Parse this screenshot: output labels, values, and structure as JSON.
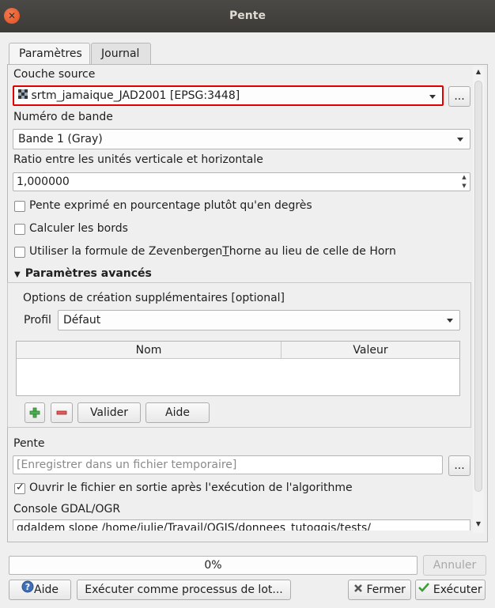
{
  "window": {
    "title": "Pente"
  },
  "tabs": [
    {
      "label": "Paramètres"
    },
    {
      "label": "Journal"
    }
  ],
  "source_layer": {
    "label": "Couche source",
    "value": "srtm_jamaique_JAD2001 [EPSG:3448]",
    "browse": "..."
  },
  "band": {
    "label": "Numéro de bande",
    "value": "Bande 1 (Gray)"
  },
  "ratio": {
    "label": "Ratio entre les unités verticale et horizontale",
    "value": "1,000000"
  },
  "options": {
    "percent": {
      "label": "Pente exprimé en pourcentage plutôt qu'en degrès",
      "checked": false
    },
    "edges": {
      "label": "Calculer les bords",
      "checked": false
    },
    "zevenbergen": {
      "label_prefix": "Utiliser la formule de Zevenbergen",
      "label_accel": "T",
      "label_suffix": "horne au lieu  de celle de Horn",
      "checked": false
    }
  },
  "advanced": {
    "label": "Paramètres avancés",
    "creation_options_label": "Options de création supplémentaires [optional]",
    "profile_label": "Profil",
    "profile_value": "Défaut",
    "columns": [
      "Nom",
      "Valeur"
    ],
    "validate_label": "Valider",
    "help_label": "Aide"
  },
  "output": {
    "label": "Pente",
    "placeholder": "[Enregistrer dans un fichier temporaire]",
    "browse": "..."
  },
  "open_after": {
    "label": "Ouvrir le fichier en sortie après l'exécution de l'algorithme",
    "checked": true
  },
  "console": {
    "label": "Console GDAL/OGR",
    "text": "gdaldem slope /home/julie/Travail/QGIS/donnees_tutoqgis/tests/"
  },
  "progress": {
    "value": 0,
    "text": "0%"
  },
  "buttons": {
    "cancel": "Annuler",
    "help": "Aide",
    "batch": "Exécuter comme processus de lot...",
    "close": "Fermer",
    "run": "Exécuter"
  }
}
